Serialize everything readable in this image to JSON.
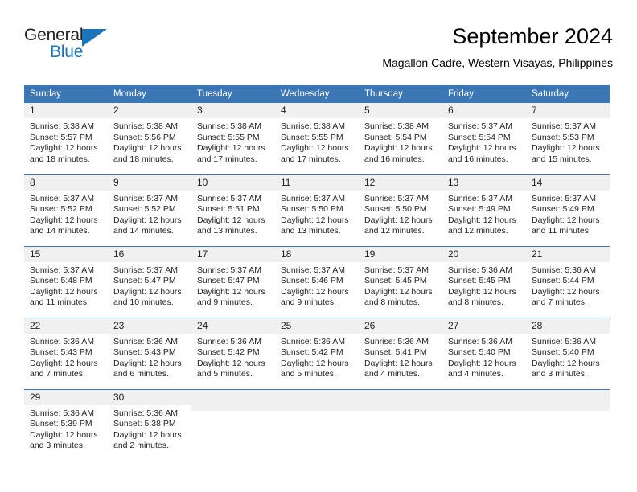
{
  "brand": {
    "name_part1": "General",
    "name_part2": "Blue",
    "accent_color": "#1b75bb",
    "logo_icon": "triangle-sail-icon"
  },
  "header": {
    "title": "September 2024",
    "subtitle": "Magallon Cadre, Western Visayas, Philippines"
  },
  "calendar": {
    "header_bg": "#3b77b5",
    "daynum_bg": "#f0f0f0",
    "weekday_headers": [
      "Sunday",
      "Monday",
      "Tuesday",
      "Wednesday",
      "Thursday",
      "Friday",
      "Saturday"
    ],
    "weeks": [
      [
        {
          "day": "1",
          "sunrise": "Sunrise: 5:38 AM",
          "sunset": "Sunset: 5:57 PM",
          "daylight1": "Daylight: 12 hours",
          "daylight2": "and 18 minutes."
        },
        {
          "day": "2",
          "sunrise": "Sunrise: 5:38 AM",
          "sunset": "Sunset: 5:56 PM",
          "daylight1": "Daylight: 12 hours",
          "daylight2": "and 18 minutes."
        },
        {
          "day": "3",
          "sunrise": "Sunrise: 5:38 AM",
          "sunset": "Sunset: 5:55 PM",
          "daylight1": "Daylight: 12 hours",
          "daylight2": "and 17 minutes."
        },
        {
          "day": "4",
          "sunrise": "Sunrise: 5:38 AM",
          "sunset": "Sunset: 5:55 PM",
          "daylight1": "Daylight: 12 hours",
          "daylight2": "and 17 minutes."
        },
        {
          "day": "5",
          "sunrise": "Sunrise: 5:38 AM",
          "sunset": "Sunset: 5:54 PM",
          "daylight1": "Daylight: 12 hours",
          "daylight2": "and 16 minutes."
        },
        {
          "day": "6",
          "sunrise": "Sunrise: 5:37 AM",
          "sunset": "Sunset: 5:54 PM",
          "daylight1": "Daylight: 12 hours",
          "daylight2": "and 16 minutes."
        },
        {
          "day": "7",
          "sunrise": "Sunrise: 5:37 AM",
          "sunset": "Sunset: 5:53 PM",
          "daylight1": "Daylight: 12 hours",
          "daylight2": "and 15 minutes."
        }
      ],
      [
        {
          "day": "8",
          "sunrise": "Sunrise: 5:37 AM",
          "sunset": "Sunset: 5:52 PM",
          "daylight1": "Daylight: 12 hours",
          "daylight2": "and 14 minutes."
        },
        {
          "day": "9",
          "sunrise": "Sunrise: 5:37 AM",
          "sunset": "Sunset: 5:52 PM",
          "daylight1": "Daylight: 12 hours",
          "daylight2": "and 14 minutes."
        },
        {
          "day": "10",
          "sunrise": "Sunrise: 5:37 AM",
          "sunset": "Sunset: 5:51 PM",
          "daylight1": "Daylight: 12 hours",
          "daylight2": "and 13 minutes."
        },
        {
          "day": "11",
          "sunrise": "Sunrise: 5:37 AM",
          "sunset": "Sunset: 5:50 PM",
          "daylight1": "Daylight: 12 hours",
          "daylight2": "and 13 minutes."
        },
        {
          "day": "12",
          "sunrise": "Sunrise: 5:37 AM",
          "sunset": "Sunset: 5:50 PM",
          "daylight1": "Daylight: 12 hours",
          "daylight2": "and 12 minutes."
        },
        {
          "day": "13",
          "sunrise": "Sunrise: 5:37 AM",
          "sunset": "Sunset: 5:49 PM",
          "daylight1": "Daylight: 12 hours",
          "daylight2": "and 12 minutes."
        },
        {
          "day": "14",
          "sunrise": "Sunrise: 5:37 AM",
          "sunset": "Sunset: 5:49 PM",
          "daylight1": "Daylight: 12 hours",
          "daylight2": "and 11 minutes."
        }
      ],
      [
        {
          "day": "15",
          "sunrise": "Sunrise: 5:37 AM",
          "sunset": "Sunset: 5:48 PM",
          "daylight1": "Daylight: 12 hours",
          "daylight2": "and 11 minutes."
        },
        {
          "day": "16",
          "sunrise": "Sunrise: 5:37 AM",
          "sunset": "Sunset: 5:47 PM",
          "daylight1": "Daylight: 12 hours",
          "daylight2": "and 10 minutes."
        },
        {
          "day": "17",
          "sunrise": "Sunrise: 5:37 AM",
          "sunset": "Sunset: 5:47 PM",
          "daylight1": "Daylight: 12 hours",
          "daylight2": "and 9 minutes."
        },
        {
          "day": "18",
          "sunrise": "Sunrise: 5:37 AM",
          "sunset": "Sunset: 5:46 PM",
          "daylight1": "Daylight: 12 hours",
          "daylight2": "and 9 minutes."
        },
        {
          "day": "19",
          "sunrise": "Sunrise: 5:37 AM",
          "sunset": "Sunset: 5:45 PM",
          "daylight1": "Daylight: 12 hours",
          "daylight2": "and 8 minutes."
        },
        {
          "day": "20",
          "sunrise": "Sunrise: 5:36 AM",
          "sunset": "Sunset: 5:45 PM",
          "daylight1": "Daylight: 12 hours",
          "daylight2": "and 8 minutes."
        },
        {
          "day": "21",
          "sunrise": "Sunrise: 5:36 AM",
          "sunset": "Sunset: 5:44 PM",
          "daylight1": "Daylight: 12 hours",
          "daylight2": "and 7 minutes."
        }
      ],
      [
        {
          "day": "22",
          "sunrise": "Sunrise: 5:36 AM",
          "sunset": "Sunset: 5:43 PM",
          "daylight1": "Daylight: 12 hours",
          "daylight2": "and 7 minutes."
        },
        {
          "day": "23",
          "sunrise": "Sunrise: 5:36 AM",
          "sunset": "Sunset: 5:43 PM",
          "daylight1": "Daylight: 12 hours",
          "daylight2": "and 6 minutes."
        },
        {
          "day": "24",
          "sunrise": "Sunrise: 5:36 AM",
          "sunset": "Sunset: 5:42 PM",
          "daylight1": "Daylight: 12 hours",
          "daylight2": "and 5 minutes."
        },
        {
          "day": "25",
          "sunrise": "Sunrise: 5:36 AM",
          "sunset": "Sunset: 5:42 PM",
          "daylight1": "Daylight: 12 hours",
          "daylight2": "and 5 minutes."
        },
        {
          "day": "26",
          "sunrise": "Sunrise: 5:36 AM",
          "sunset": "Sunset: 5:41 PM",
          "daylight1": "Daylight: 12 hours",
          "daylight2": "and 4 minutes."
        },
        {
          "day": "27",
          "sunrise": "Sunrise: 5:36 AM",
          "sunset": "Sunset: 5:40 PM",
          "daylight1": "Daylight: 12 hours",
          "daylight2": "and 4 minutes."
        },
        {
          "day": "28",
          "sunrise": "Sunrise: 5:36 AM",
          "sunset": "Sunset: 5:40 PM",
          "daylight1": "Daylight: 12 hours",
          "daylight2": "and 3 minutes."
        }
      ],
      [
        {
          "day": "29",
          "sunrise": "Sunrise: 5:36 AM",
          "sunset": "Sunset: 5:39 PM",
          "daylight1": "Daylight: 12 hours",
          "daylight2": "and 3 minutes."
        },
        {
          "day": "30",
          "sunrise": "Sunrise: 5:36 AM",
          "sunset": "Sunset: 5:38 PM",
          "daylight1": "Daylight: 12 hours",
          "daylight2": "and 2 minutes."
        },
        {
          "day": "",
          "sunrise": "",
          "sunset": "",
          "daylight1": "",
          "daylight2": ""
        },
        {
          "day": "",
          "sunrise": "",
          "sunset": "",
          "daylight1": "",
          "daylight2": ""
        },
        {
          "day": "",
          "sunrise": "",
          "sunset": "",
          "daylight1": "",
          "daylight2": ""
        },
        {
          "day": "",
          "sunrise": "",
          "sunset": "",
          "daylight1": "",
          "daylight2": ""
        },
        {
          "day": "",
          "sunrise": "",
          "sunset": "",
          "daylight1": "",
          "daylight2": ""
        }
      ]
    ]
  }
}
